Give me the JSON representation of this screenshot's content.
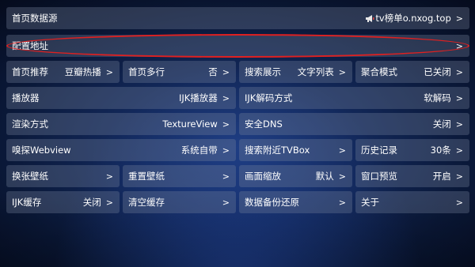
{
  "rows": {
    "homepage_source": {
      "label": "首页数据源",
      "value": "tv榜单o.nxog.top",
      "icon": "megaphone-icon"
    },
    "config_address": {
      "label": "配置地址"
    },
    "row3": {
      "home_recommend": {
        "label": "首页推荐",
        "value": "豆瓣热播"
      },
      "home_multirow": {
        "label": "首页多行",
        "value": "否"
      },
      "search_display": {
        "label": "搜索展示",
        "value": "文字列表"
      },
      "aggregate_mode": {
        "label": "聚合模式",
        "value": "已关闭"
      }
    },
    "row4": {
      "player": {
        "label": "播放器",
        "value": "IJK播放器"
      },
      "ijk_decode": {
        "label": "IJK解码方式",
        "value": "软解码"
      }
    },
    "row5": {
      "render_mode": {
        "label": "渲染方式",
        "value": "TextureView"
      },
      "secure_dns": {
        "label": "安全DNS",
        "value": "关闭"
      }
    },
    "row6": {
      "sniff_webview": {
        "label": "嗅探Webview",
        "value": "系统自带"
      },
      "search_nearby": {
        "label": "搜索附近TVBox"
      },
      "history": {
        "label": "历史记录",
        "value": "30条"
      }
    },
    "row7": {
      "change_wallpaper": {
        "label": "换张壁纸"
      },
      "reset_wallpaper": {
        "label": "重置壁纸"
      },
      "picture_zoom": {
        "label": "画面缩放",
        "value": "默认"
      },
      "window_preview": {
        "label": "窗口预览",
        "value": "开启"
      }
    },
    "row8": {
      "ijk_cache": {
        "label": "IJK缓存",
        "value": "关闭"
      },
      "clear_cache": {
        "label": "清空缓存"
      },
      "backup_restore": {
        "label": "数据备份还原"
      },
      "about": {
        "label": "关于"
      }
    }
  },
  "chevron": ">",
  "colors": {
    "highlight": "#e02020",
    "tile_bg": "rgba(120,135,160,0.32)"
  }
}
